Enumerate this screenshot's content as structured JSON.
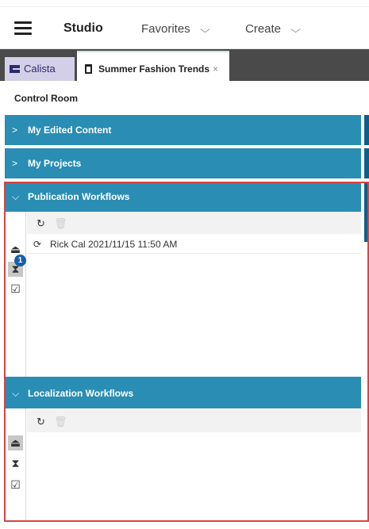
{
  "header": {
    "brand": "Studio",
    "menus": [
      {
        "label": "Favorites",
        "chevron": "⌵"
      },
      {
        "label": "Create",
        "chevron": "⌵"
      }
    ]
  },
  "tabs": [
    {
      "label": "Calista",
      "icon": "list-icon"
    },
    {
      "label": "Summer Fashion Trends",
      "icon": "document-icon",
      "close": "×"
    }
  ],
  "control_room": {
    "title": "Control Room"
  },
  "sections": [
    {
      "label": "My Edited Content",
      "arrow": ">",
      "expanded": false
    },
    {
      "label": "My Projects",
      "arrow": ">",
      "expanded": false
    },
    {
      "label": "Publication Workflows",
      "arrow": "⌵",
      "expanded": true
    },
    {
      "label": "Localization Workflows",
      "arrow": "⌵",
      "expanded": true
    }
  ],
  "publication_workflows": {
    "toolbar": {
      "refresh_icon": "refresh-icon",
      "delete_icon": "trash-icon"
    },
    "sidebar": {
      "inbox_icon": "inbox-icon",
      "pending_icon": "hourglass-icon",
      "pending_badge": "1",
      "done_icon": "checkbox-icon"
    },
    "rows": [
      {
        "text": "Rick Cal 2021/11/15 11:50 AM",
        "icon": "workflow-cycle-icon"
      }
    ]
  },
  "localization_workflows": {
    "toolbar": {
      "refresh_icon": "refresh-icon",
      "delete_icon": "trash-icon"
    },
    "sidebar": {
      "inbox_icon": "inbox-icon",
      "pending_icon": "hourglass-icon",
      "done_icon": "checkbox-icon"
    }
  },
  "colors": {
    "section_header": "#2a8db3",
    "section_strip": "#0d5f86",
    "tab_strip": "#4a4a4a",
    "highlight": "#d64545",
    "badge": "#1560a8"
  }
}
